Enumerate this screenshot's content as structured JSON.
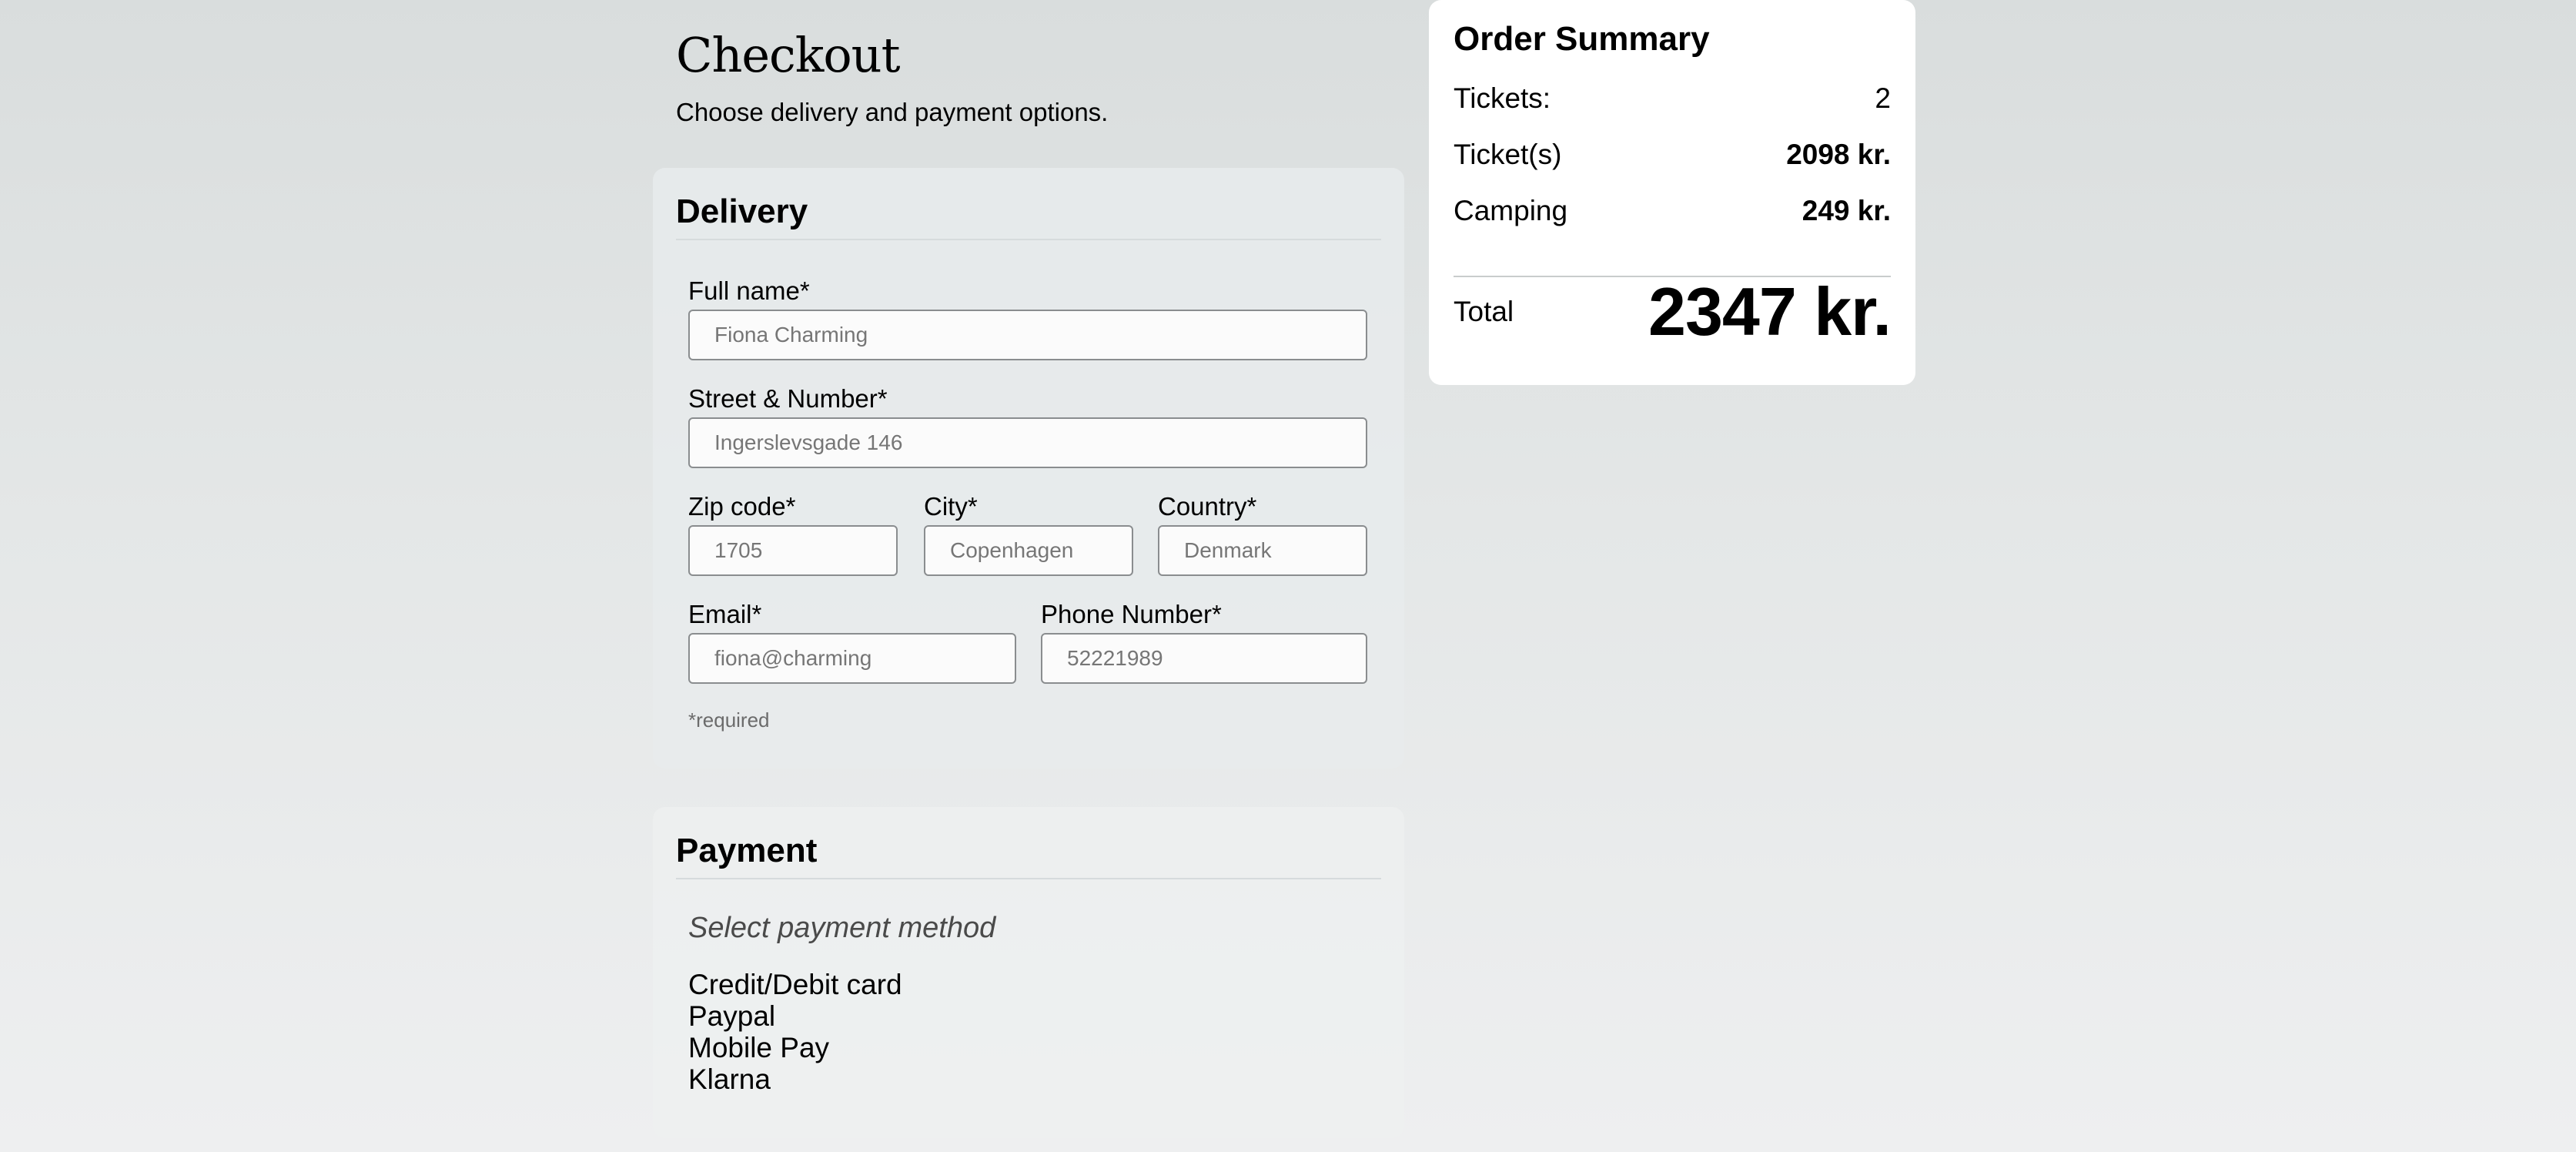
{
  "header": {
    "title": "Checkout",
    "subtitle": "Choose delivery and payment options."
  },
  "delivery": {
    "heading": "Delivery",
    "fields": {
      "full_name": {
        "label": "Full name*",
        "placeholder": "Fiona Charming"
      },
      "street": {
        "label": "Street & Number*",
        "placeholder": "Ingerslevsgade 146"
      },
      "zip": {
        "label": "Zip code*",
        "placeholder": "1705"
      },
      "city": {
        "label": "City*",
        "placeholder": "Copenhagen"
      },
      "country": {
        "label": "Country*",
        "placeholder": "Denmark"
      },
      "email": {
        "label": "Email*",
        "placeholder": "fiona@charming"
      },
      "phone": {
        "label": "Phone Number*",
        "placeholder": "52221989"
      }
    },
    "required_note": "*required"
  },
  "payment": {
    "heading": "Payment",
    "prompt": "Select payment method",
    "options": [
      "Credit/Debit card",
      "Paypal",
      "Mobile Pay",
      "Klarna"
    ]
  },
  "summary": {
    "title": "Order Summary",
    "rows": [
      {
        "label": "Tickets:",
        "value": "2"
      },
      {
        "label": "Ticket(s)",
        "value": "2098 kr."
      },
      {
        "label": "Camping",
        "value": "249 kr."
      }
    ],
    "total_label": "Total",
    "total_value": "2347 kr."
  }
}
